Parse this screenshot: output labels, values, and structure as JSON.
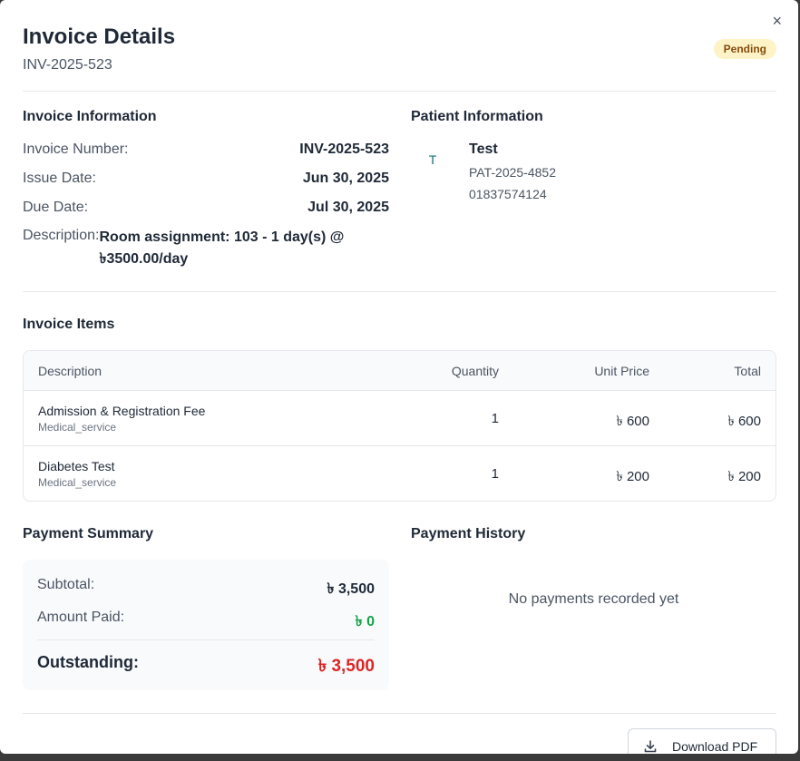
{
  "modal": {
    "title": "Invoice Details",
    "invoice_id": "INV-2025-523",
    "status": "Pending",
    "close_symbol": "×"
  },
  "invoice_info": {
    "heading": "Invoice Information",
    "number_label": "Invoice Number:",
    "number_value": "INV-2025-523",
    "issue_label": "Issue Date:",
    "issue_value": "Jun 30, 2025",
    "due_label": "Due Date:",
    "due_value": "Jul 30, 2025",
    "desc_label": "Description:",
    "desc_value": "Room assignment: 103 - 1 day(s) @ ৳3500.00/day"
  },
  "patient": {
    "heading": "Patient Information",
    "initial": "T",
    "name": "Test",
    "id": "PAT-2025-4852",
    "phone": "01837574124"
  },
  "items": {
    "heading": "Invoice Items",
    "columns": [
      "Description",
      "Quantity",
      "Unit Price",
      "Total"
    ],
    "rows": [
      {
        "name": "Admission & Registration Fee",
        "category": "Medical_service",
        "qty": "1",
        "unit": "৳ 600",
        "total": "৳ 600"
      },
      {
        "name": "Diabetes Test",
        "category": "Medical_service",
        "qty": "1",
        "unit": "৳ 200",
        "total": "৳ 200"
      }
    ]
  },
  "summary": {
    "heading": "Payment Summary",
    "subtotal_label": "Subtotal:",
    "subtotal_value": "৳ 3,500",
    "paid_label": "Amount Paid:",
    "paid_value": "৳ 0",
    "outstanding_label": "Outstanding:",
    "outstanding_value": "৳ 3,500"
  },
  "history": {
    "heading": "Payment History",
    "empty_text": "No payments recorded yet"
  },
  "footer": {
    "download_label": "Download PDF",
    "download_icon": "download-icon"
  },
  "colors": {
    "badge_bg": "#fef3c7",
    "badge_text": "#854d0e",
    "outstanding": "#dc2626",
    "paid": "#16a34a"
  }
}
